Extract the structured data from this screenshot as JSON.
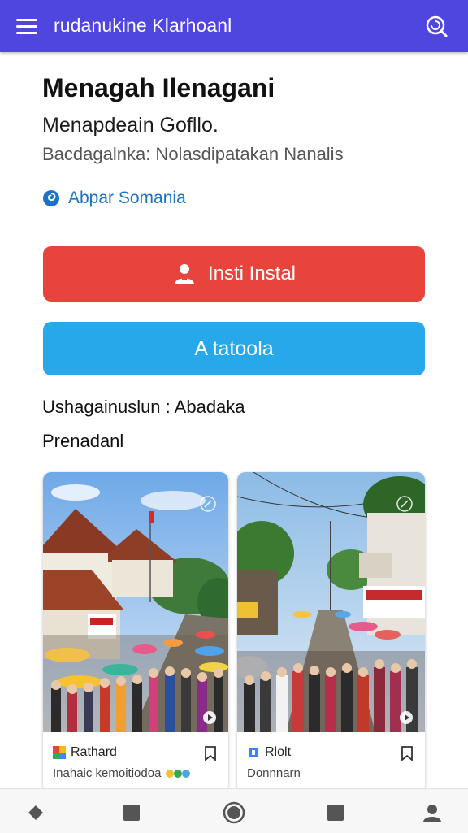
{
  "app_bar": {
    "title": "rudanukine Klarhoanl",
    "menu_icon": "hamburger-menu-icon",
    "right_icon": "search-refresh-icon",
    "color": "#4f46e0"
  },
  "header": {
    "title": "Menagah Ilenagani",
    "subtitle": "Menapdeain Gofllo.",
    "meta": "Bacdagalnka: Nolasdipatakan Nanalis"
  },
  "author": {
    "name": "Abpar Somania",
    "icon": "spiral-logo-icon",
    "color": "#1a73c8"
  },
  "buttons": {
    "install_label": "Insti Instal",
    "install_icon": "user-icon",
    "install_color": "#e9443b",
    "secondary_label": "A tatoola",
    "secondary_color": "#27a8ea"
  },
  "info": {
    "line1": "Ushagainuslun : Abadaka",
    "line2": "Prenadanl"
  },
  "cards": [
    {
      "source": "Rathard",
      "snippet": "Inahaic kemoitiodoa",
      "source_icon": "colorful-source-icon",
      "bookmark_icon": "bookmark-icon"
    },
    {
      "source": "Rlolt",
      "snippet": "Donnnarn",
      "source_icon": "blue-source-icon",
      "bookmark_icon": "bookmark-icon"
    }
  ],
  "bottom_nav": [
    {
      "name": "nav-home",
      "icon": "diamond-icon"
    },
    {
      "name": "nav-grid",
      "icon": "square-icon"
    },
    {
      "name": "nav-center",
      "icon": "circle-icon"
    },
    {
      "name": "nav-library",
      "icon": "square-icon"
    },
    {
      "name": "nav-profile",
      "icon": "person-icon"
    }
  ]
}
